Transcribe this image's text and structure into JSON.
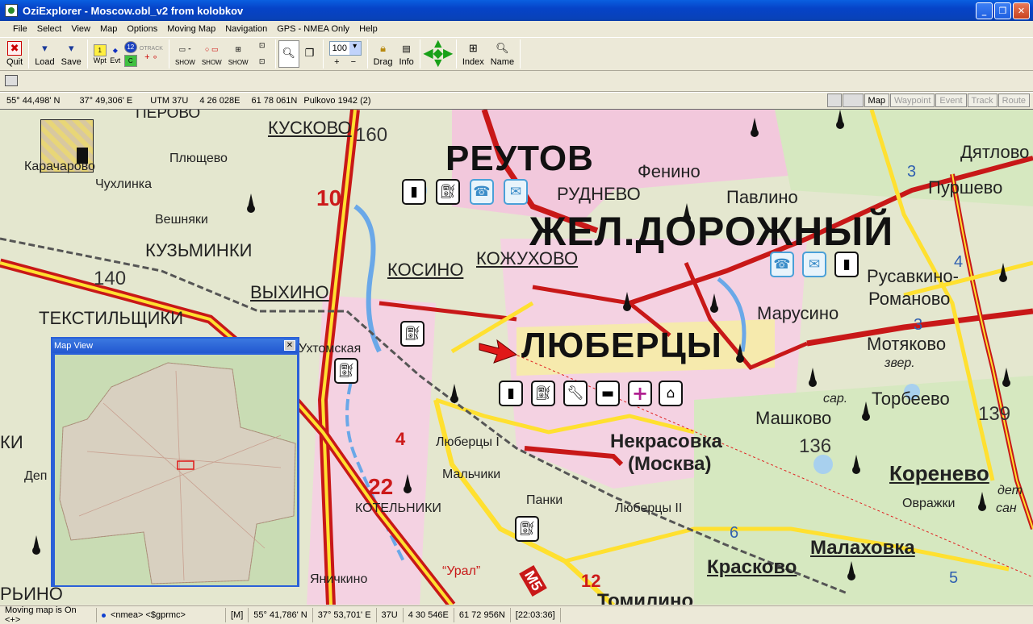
{
  "window": {
    "title": "OziExplorer - Moscow.obl_v2 from kolobkov"
  },
  "menu": [
    "File",
    "Select",
    "View",
    "Map",
    "Options",
    "Moving Map",
    "Navigation",
    "GPS - NMEA Only",
    "Help"
  ],
  "toolbar": {
    "quit": "Quit",
    "load": "Load",
    "save": "Save",
    "wpt": "Wpt",
    "evt": "Evt",
    "otrack": "OTRACK",
    "show": "SHOW",
    "zoom_value": "100",
    "drag": "Drag",
    "info": "Info",
    "index": "Index",
    "name": "Name"
  },
  "infobar": {
    "lat": "55° 44,498' N",
    "lon": "37° 49,306' E",
    "utm": "UTM  37U",
    "easting": "4 26 028E",
    "northing": "61 78 061N",
    "datum": "Pulkovo 1942 (2)",
    "buttons": [
      {
        "label": "Map",
        "enabled": true
      },
      {
        "label": "Waypoint",
        "enabled": false
      },
      {
        "label": "Event",
        "enabled": false
      },
      {
        "label": "Track",
        "enabled": false
      },
      {
        "label": "Route",
        "enabled": false
      }
    ]
  },
  "map": {
    "labels": {
      "perovo": "ПЕРОВО",
      "kuskovo": "КУСКОВО",
      "karacharovo": "Карачарово",
      "plyushchevo": "Плющево",
      "chukhlinka": "Чухлинка",
      "veshnyaki": "Вешняки",
      "kuzminki": "КУЗЬМИНКИ",
      "vykhino": "ВЫХИНО",
      "tekstilshchiki": "ТЕКСТИЛЬЩИКИ",
      "reutov": "РЕУТОВ",
      "rudnevo": "РУДНЕВО",
      "fenino": "Фенино",
      "pavlino": "Павлино",
      "zheldor": "ЖЕЛ.ДОРОЖНЫЙ",
      "kosino": "КОСИНО",
      "kozhukhovo": "КОЖУХОВО",
      "dyatlovo": "Дятлово",
      "purshevo": "Пуршево",
      "rusavkino": "Русавкино-",
      "romanovo": "Романово",
      "marusino": "Марусино",
      "lyubertsy": "ЛЮБЕРЦЫ",
      "ukhtomskaya": "Ухтомская",
      "motyakovo": "Мотяково",
      "zver": "звер.",
      "sar": "сар.",
      "torbeevo": "Торбеево",
      "mashkovo": "Машково",
      "nekrasovka": "Некрасовка",
      "moskva": "(Москва)",
      "lyubertsy1": "Люберцы I",
      "malchiki": "Мальчики",
      "panki": "Панки",
      "lyubertsy2": "Люберцы II",
      "kotelniki": "КОТЕЛЬНИКИ",
      "ovrazhki": "Овражки",
      "korenevo": "Коренево",
      "malakhovka": "Малаховка",
      "kraskovo": "Красково",
      "tomilino": "Томилино",
      "yanichkino": "Яничкино",
      "ural": "“Урал”",
      "detsan1": "дет",
      "detsan2": "сан",
      "lyubertsy_left": "РЬИНО",
      "ki": "КИ",
      "dep": "Деп"
    },
    "numbers": {
      "n160": "160",
      "n140": "140",
      "n136": "136",
      "n139": "139",
      "r10": "10",
      "r22": "22",
      "r4": "4",
      "r12": "12",
      "m5": "М5",
      "b3a": "3",
      "b3b": "3",
      "b4": "4",
      "b6": "6",
      "b5": "5"
    }
  },
  "mapview": {
    "title": "Map View"
  },
  "status": {
    "moving": "Moving map is On  <+>",
    "nmea": "<nmea> <$gprmc>",
    "mode": "[M]",
    "lat": "55° 41,786' N",
    "lon": "37° 53,701' E",
    "zone": "37U",
    "easting": "4 30 546E",
    "northing": "61 72 956N",
    "time": "[22:03:36]"
  }
}
